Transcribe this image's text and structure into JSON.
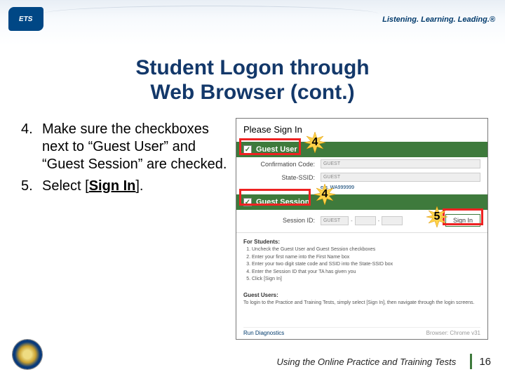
{
  "logo": "ETS",
  "tagline": "Listening. Learning. Leading.®",
  "title_line1": "Student Logon through",
  "title_line2": "Web Browser (cont.)",
  "steps": {
    "s4_num": "4.",
    "s4_text": "Make sure the checkboxes next to “Guest User” and “Guest Session” are checked.",
    "s5_num": "5.",
    "s5_prefix": "Select [",
    "s5_bold": "Sign In",
    "s5_suffix": "]."
  },
  "screenshot": {
    "heading": "Please Sign In",
    "guest_user_label": "Guest User",
    "conf_code_label": "Confirmation Code:",
    "conf_code_value": "GUEST",
    "ssid_label": "State-SSID:",
    "ssid_value": "GUEST",
    "ssid_link": "e.g. WA999999",
    "guest_session_label": "Guest Session",
    "session_id_label": "Session ID:",
    "seg1": "GUEST",
    "seg2": "",
    "seg3": "",
    "sign_in": "Sign In",
    "for_students": "For Students:",
    "fs1": "Uncheck the Guest User and Guest Session checkboxes",
    "fs2": "Enter your first name into the First Name box",
    "fs3": "Enter your two digit state code and SSID into the State-SSID box",
    "fs4": "Enter the Session ID that your TA has given you",
    "fs5": "Click [Sign In]",
    "guest_users": "Guest Users:",
    "gu_text": "To login to the Practice and Training Tests, simply select [Sign In], then navigate through the login screens.",
    "diag": "Run Diagnostics",
    "browser": "Browser: Chrome v31"
  },
  "callouts": {
    "c4": "4",
    "c5": "5"
  },
  "footer": {
    "text": "Using the Online Practice and Training Tests",
    "page": "16"
  }
}
